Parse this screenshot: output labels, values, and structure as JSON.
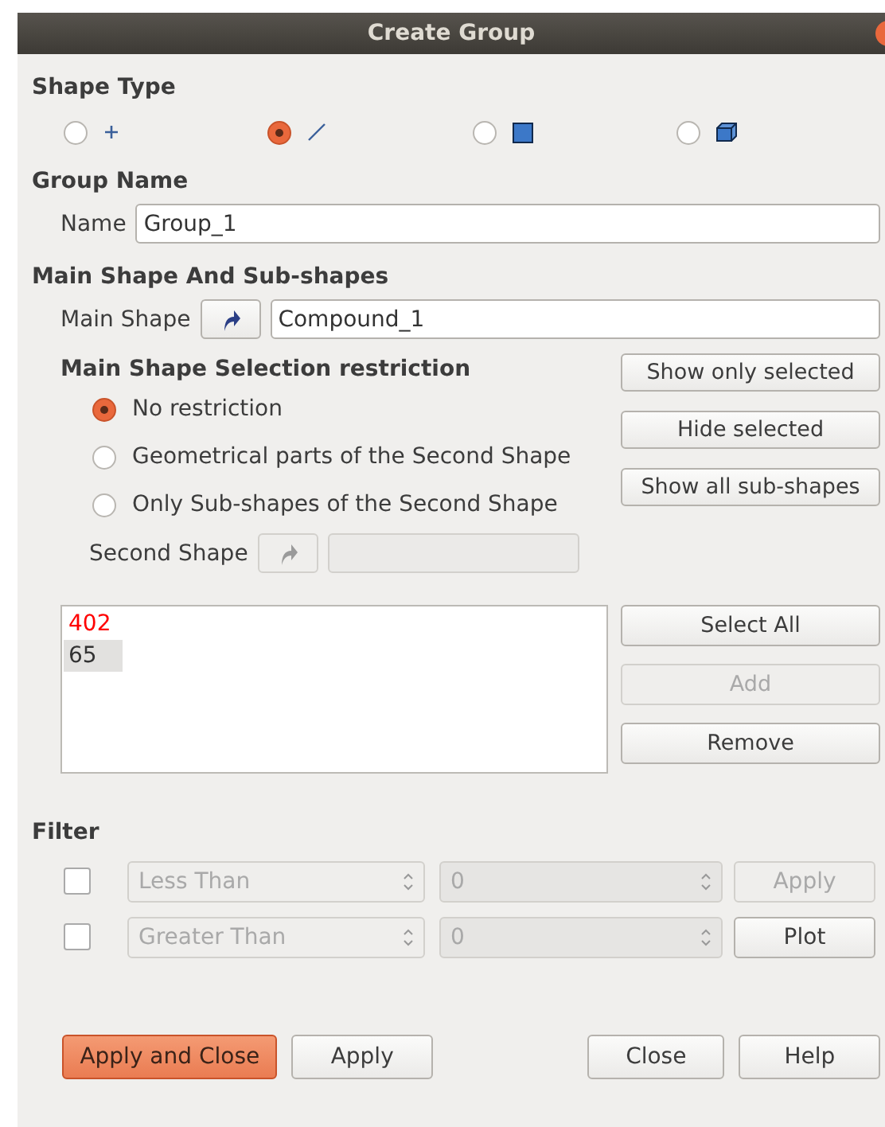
{
  "window": {
    "title": "Create Group"
  },
  "shape_type": {
    "label": "Shape Type",
    "options": [
      {
        "kind": "vertex",
        "selected": false
      },
      {
        "kind": "edge",
        "selected": true
      },
      {
        "kind": "face",
        "selected": false
      },
      {
        "kind": "solid",
        "selected": false
      }
    ]
  },
  "group_name": {
    "label": "Group Name",
    "name_label": "Name",
    "value": "Group_1"
  },
  "main_shape": {
    "label": "Main Shape And Sub-shapes",
    "field_label": "Main Shape",
    "value": "Compound_1",
    "restriction_label": "Main Shape Selection restriction",
    "restrictions": [
      {
        "label": "No restriction",
        "selected": true
      },
      {
        "label": "Geometrical parts of the Second Shape",
        "selected": false
      },
      {
        "label": "Only Sub-shapes of the Second Shape",
        "selected": false
      }
    ],
    "second_shape_label": "Second Shape",
    "buttons": [
      {
        "label": "Show only selected"
      },
      {
        "label": "Hide selected"
      },
      {
        "label": "Show all sub-shapes"
      }
    ]
  },
  "ids": {
    "items": [
      {
        "text": "402",
        "color": "#ff0000",
        "selected": false
      },
      {
        "text": "65",
        "color": "#333333",
        "selected": true
      }
    ],
    "buttons": [
      {
        "label": "Select All",
        "disabled": false
      },
      {
        "label": "Add",
        "disabled": true
      },
      {
        "label": "Remove",
        "disabled": false
      }
    ]
  },
  "filter": {
    "label": "Filter",
    "rows": [
      {
        "checked": false,
        "condition": "Less Than",
        "value": "0",
        "button": {
          "label": "Apply",
          "disabled": true
        }
      },
      {
        "checked": false,
        "condition": "Greater Than",
        "value": "0",
        "button": {
          "label": "Plot",
          "disabled": false
        }
      }
    ]
  },
  "footer": [
    {
      "label": "Apply and Close",
      "primary": true
    },
    {
      "label": "Apply",
      "primary": false
    },
    {
      "label": "Close",
      "primary": false
    },
    {
      "label": "Help",
      "primary": false
    }
  ]
}
